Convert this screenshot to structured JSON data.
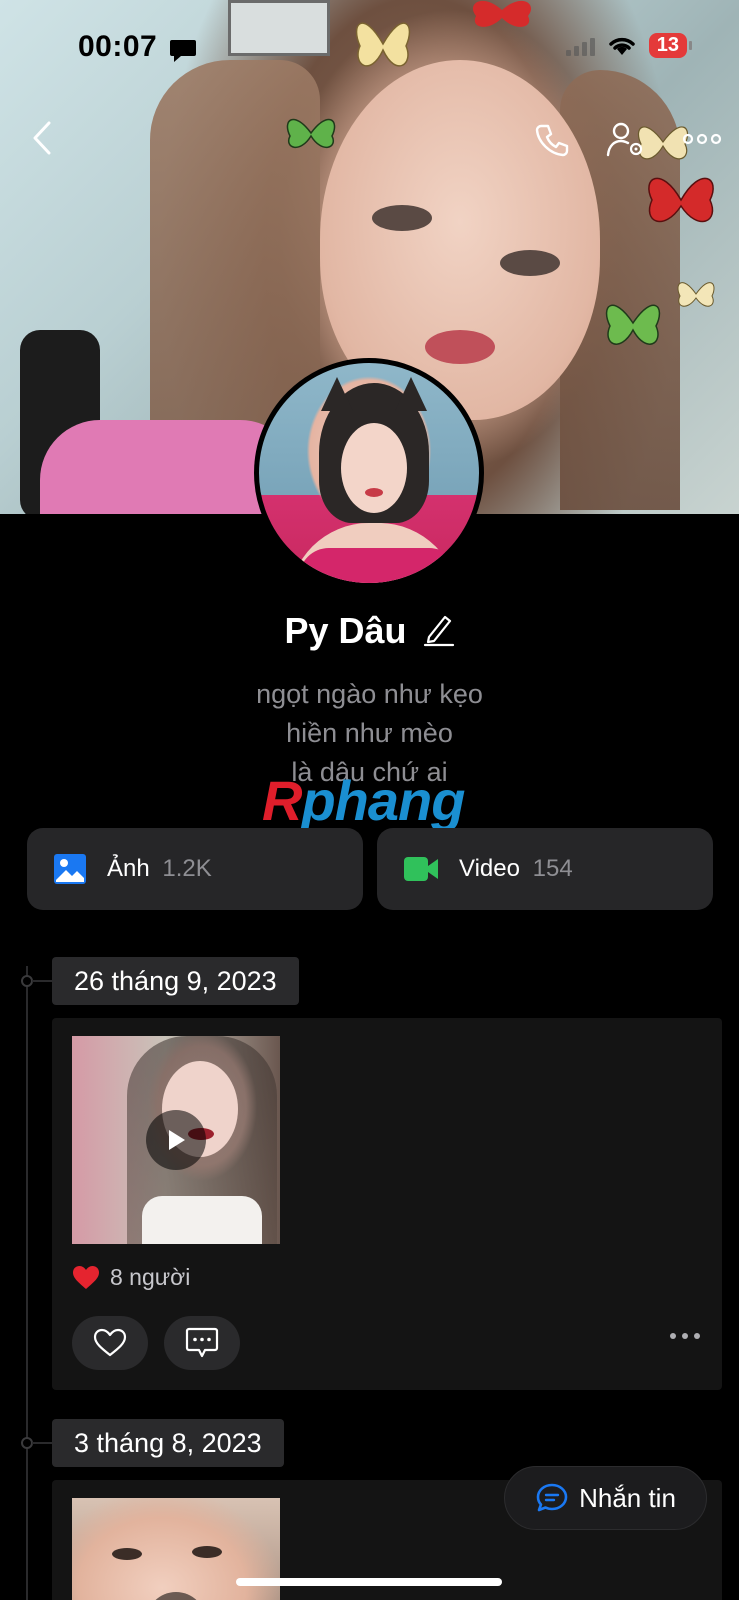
{
  "status_bar": {
    "time": "00:07",
    "battery": "13"
  },
  "profile": {
    "name": "Py Dâu",
    "bio": [
      "ngọt ngào như kẹo",
      "hiền như mèo",
      "là dâu chứ ai"
    ]
  },
  "watermark": {
    "first_letter": "R",
    "rest": "phang"
  },
  "media": {
    "photos_label": "Ảnh",
    "photos_count": "1.2K",
    "videos_label": "Video",
    "videos_count": "154"
  },
  "timeline": [
    {
      "date": "26 tháng 9, 2023",
      "reactions": "8 người"
    },
    {
      "date": "3 tháng 8, 2023"
    }
  ],
  "message_button": {
    "label": "Nhắn tin"
  },
  "icons": {
    "back": "chevron-left-icon",
    "call": "phone-icon",
    "settings": "user-settings-icon",
    "more": "more-icon",
    "edit": "pencil-icon",
    "photo": "image-icon",
    "video": "video-icon",
    "play": "play-icon",
    "heart": "heart-icon",
    "comment": "comment-icon",
    "message": "message-icon"
  },
  "colors": {
    "accent_blue": "#1a78f2",
    "video_green": "#30c15b",
    "heart_red": "#e5242f",
    "battery_red": "#e43a3a"
  }
}
